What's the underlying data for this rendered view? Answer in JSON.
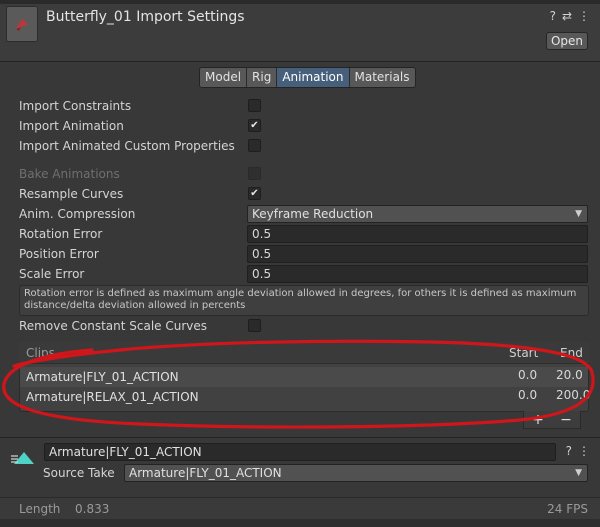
{
  "header": {
    "title": "Butterfly_01 Import Settings",
    "open_label": "Open",
    "help_icon": "?",
    "settings_icon": "⇄",
    "menu_icon": "⋮"
  },
  "tabs": [
    {
      "label": "Model",
      "active": false
    },
    {
      "label": "Rig",
      "active": false
    },
    {
      "label": "Animation",
      "active": true
    },
    {
      "label": "Materials",
      "active": false
    }
  ],
  "settings": {
    "import_constraints": {
      "label": "Import Constraints",
      "checked": false
    },
    "import_animation": {
      "label": "Import Animation",
      "checked": true
    },
    "import_custom_props": {
      "label": "Import Animated Custom Properties",
      "checked": false
    },
    "bake_animations": {
      "label": "Bake Animations",
      "checked": false,
      "disabled": true
    },
    "resample_curves": {
      "label": "Resample Curves",
      "checked": true
    },
    "anim_compression": {
      "label": "Anim. Compression",
      "value": "Keyframe Reduction"
    },
    "rotation_error": {
      "label": "Rotation Error",
      "value": "0.5"
    },
    "position_error": {
      "label": "Position Error",
      "value": "0.5"
    },
    "scale_error": {
      "label": "Scale Error",
      "value": "0.5"
    },
    "help_text": "Rotation error is defined as maximum angle deviation allowed in degrees, for others it is defined as maximum distance/delta deviation allowed in percents",
    "remove_constant_scale": {
      "label": "Remove Constant Scale Curves",
      "checked": false
    }
  },
  "clips": {
    "header_label": "Clips",
    "start_label": "Start",
    "end_label": "End",
    "rows": [
      {
        "name": "Armature|FLY_01_ACTION",
        "start": "0.0",
        "end": "20.0"
      },
      {
        "name": "Armature|RELAX_01_ACTION",
        "start": "0.0",
        "end": "200.0"
      }
    ],
    "add_label": "+",
    "remove_label": "−"
  },
  "clip_editor": {
    "name": "Armature|FLY_01_ACTION",
    "source_take_label": "Source Take",
    "source_take_value": "Armature|FLY_01_ACTION",
    "length_label": "Length",
    "length_value": "0.833",
    "fps": "24 FPS"
  },
  "colors": {
    "accent": "#46607c",
    "annotation": "#d0161b"
  }
}
